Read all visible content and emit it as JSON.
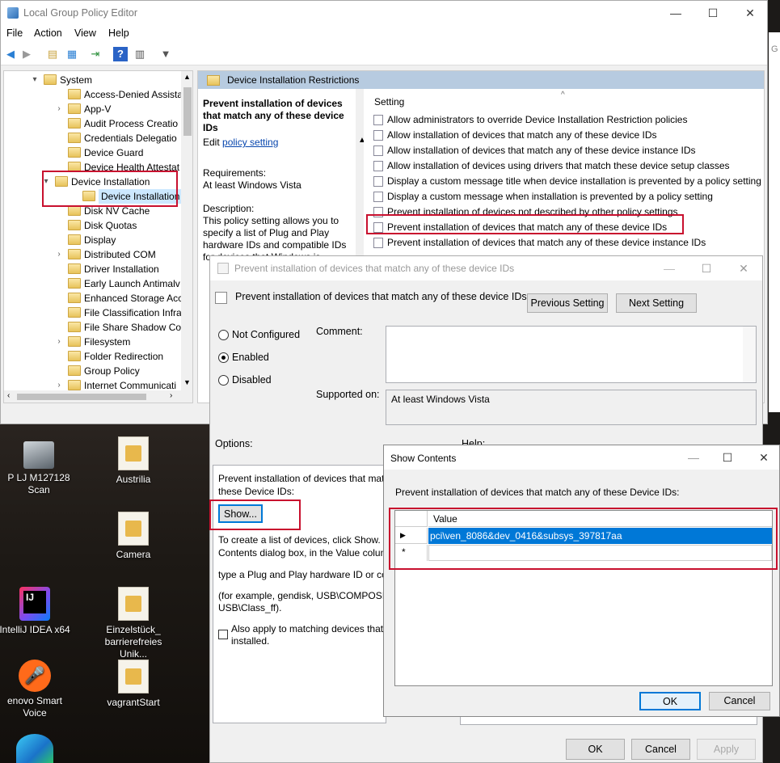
{
  "gpe": {
    "title": "Local Group Policy Editor",
    "menu": [
      "File",
      "Action",
      "View",
      "Help"
    ],
    "tree": [
      {
        "label": "System",
        "expanded": true
      },
      {
        "label": "Access-Denied Assista"
      },
      {
        "label": "App-V"
      },
      {
        "label": "Audit Process Creatio"
      },
      {
        "label": "Credentials Delegatio"
      },
      {
        "label": "Device Guard"
      },
      {
        "label": "Device Health Attestat"
      },
      {
        "label": "Device Installation",
        "expanded": true
      },
      {
        "label": "Device Installation",
        "selected": true
      },
      {
        "label": "Disk NV Cache"
      },
      {
        "label": "Disk Quotas"
      },
      {
        "label": "Display"
      },
      {
        "label": "Distributed COM"
      },
      {
        "label": "Driver Installation"
      },
      {
        "label": "Early Launch Antimalv"
      },
      {
        "label": "Enhanced Storage Acc"
      },
      {
        "label": "File Classification Infra"
      },
      {
        "label": "File Share Shadow Cop"
      },
      {
        "label": "Filesystem"
      },
      {
        "label": "Folder Redirection"
      },
      {
        "label": "Group Policy"
      },
      {
        "label": "Internet Communicati"
      }
    ],
    "pane_header": "Device Installation Restrictions",
    "description": {
      "heading": "Prevent installation of devices that match any of these device IDs",
      "edit_prefix": "Edit",
      "edit_link": "policy setting",
      "requirements_label": "Requirements:",
      "requirements_value": "At least Windows Vista",
      "description_label": "Description:",
      "description_lines": [
        "This policy setting allows you to",
        "specify a list of Plug and Play",
        "hardware IDs and compatible IDs",
        "for devices that Windows is"
      ]
    },
    "settings_header": "Setting",
    "settings": [
      "Allow administrators to override Device Installation Restriction policies",
      "Allow installation of devices that match any of these device IDs",
      "Allow installation of devices that match any of these device instance IDs",
      "Allow installation of devices using drivers that match these device setup classes",
      "Display a custom message title when device installation is prevented by a policy setting",
      "Display a custom message when installation is prevented by a policy setting",
      "Prevent installation of devices not described by other policy settings",
      "Prevent installation of devices that match any of these device IDs",
      "Prevent installation of devices that match any of these device instance IDs"
    ]
  },
  "desktop": {
    "icons": [
      {
        "label": "P LJ M127128 Scan",
        "icon": "scanner-icon"
      },
      {
        "label": "Austrilia",
        "icon": "folder-icon"
      },
      {
        "label": "Camera",
        "icon": "folder-icon"
      },
      {
        "label": "IntelliJ IDEA x64",
        "icon": "intellij-icon"
      },
      {
        "label": "Einzelstück_ barrierefreies Unik...",
        "icon": "document-icon"
      },
      {
        "label": "enovo Smart Voice",
        "icon": "microphone-icon"
      },
      {
        "label": "vagrantStart",
        "icon": "document-icon"
      }
    ]
  },
  "policy_dialog": {
    "title": "Prevent installation of devices that match any of these device IDs",
    "heading": "Prevent installation of devices that match any of these device IDs",
    "prev_button": "Previous Setting",
    "next_button": "Next Setting",
    "radio_not_configured": "Not Configured",
    "radio_enabled": "Enabled",
    "radio_disabled": "Disabled",
    "selected_state": "Enabled",
    "comment_label": "Comment:",
    "supported_label": "Supported on:",
    "supported_value": "At least Windows Vista",
    "options_label": "Options:",
    "help_label": "Help:",
    "options_text_1": "Prevent installation of devices that matc",
    "options_text_2": "these Device IDs:",
    "show_button": "Show...",
    "options_para_1a": "To create a list of devices, click Show. In",
    "options_para_1b": "Contents dialog box, in the Value colum",
    "options_para_2": "type a Plug and Play hardware ID or cor",
    "options_para_3a": "(for example, gendisk, USB\\COMPOSITE",
    "options_para_3b": "USB\\Class_ff).",
    "also_apply_1": "Also apply to matching devices that",
    "also_apply_2": "installed.",
    "ok_button": "OK",
    "cancel_button": "Cancel",
    "apply_button": "Apply"
  },
  "show_contents": {
    "title": "Show Contents",
    "prompt": "Prevent installation of devices that match any of these Device IDs:",
    "column_header": "Value",
    "rows": [
      "pci\\ven_8086&dev_0416&subsys_397817aa",
      ""
    ],
    "ok_button": "OK",
    "cancel_button": "Cancel"
  }
}
